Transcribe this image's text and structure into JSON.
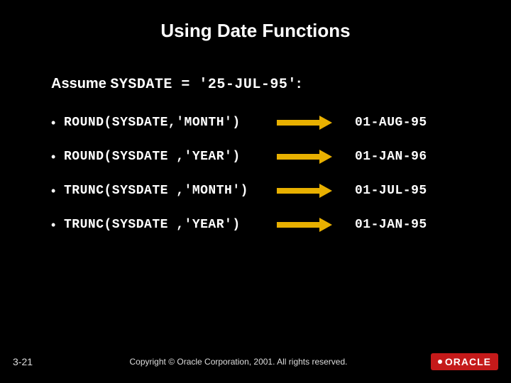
{
  "title": "Using Date Functions",
  "assume": {
    "label": "Assume ",
    "expr": "SYSDATE = '25-JUL-95'",
    "suffix": ":"
  },
  "rows": [
    {
      "expr": "ROUND(SYSDATE,'MONTH')",
      "result": "01-AUG-95"
    },
    {
      "expr": "ROUND(SYSDATE ,'YEAR')",
      "result": "01-JAN-96"
    },
    {
      "expr": "TRUNC(SYSDATE ,'MONTH')",
      "result": "01-JUL-95"
    },
    {
      "expr": "TRUNC(SYSDATE ,'YEAR')",
      "result": "01-JAN-95"
    }
  ],
  "footer": {
    "page": "3-21",
    "copyright": "Copyright © Oracle Corporation, 2001. All rights reserved.",
    "logo_text": "ORACLE"
  }
}
